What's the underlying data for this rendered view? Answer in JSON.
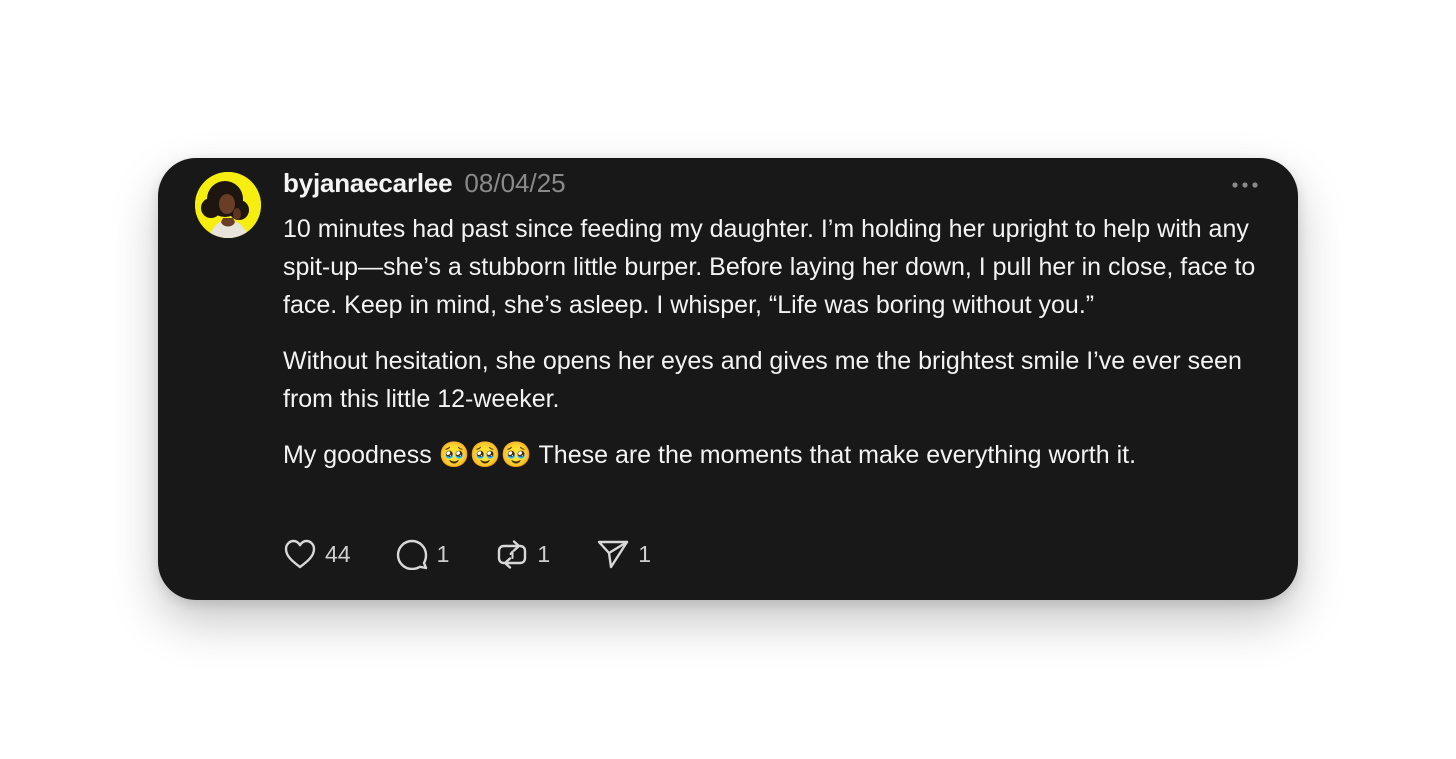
{
  "post": {
    "username": "byjanaecarlee",
    "date": "08/04/25",
    "paragraphs": [
      "10 minutes had past since feeding my daughter. I’m holding her upright to help with any spit-up—she’s a stubborn little burper. Before laying her down, I pull her in close, face to face. Keep in mind, she’s asleep. I whisper, “Life was boring without you.”",
      "Without hesitation, she opens her eyes and gives me the brightest smile I’ve ever seen from this little 12-weeker.",
      "My goodness 🥹🥹🥹 These are the moments that make everything worth it."
    ],
    "actions": {
      "likes": "44",
      "replies": "1",
      "reposts": "1",
      "shares": "1"
    }
  },
  "icons": {
    "like": "heart-icon",
    "reply": "speech-bubble-icon",
    "repost": "repost-arrows-icon",
    "share": "send-paper-plane-icon",
    "more": "more-horizontal-icon"
  },
  "colors": {
    "card_background": "#181818",
    "avatar_ring": "#f5ee10",
    "text_primary": "#f3f3f3",
    "text_secondary": "#8a8a8a"
  }
}
